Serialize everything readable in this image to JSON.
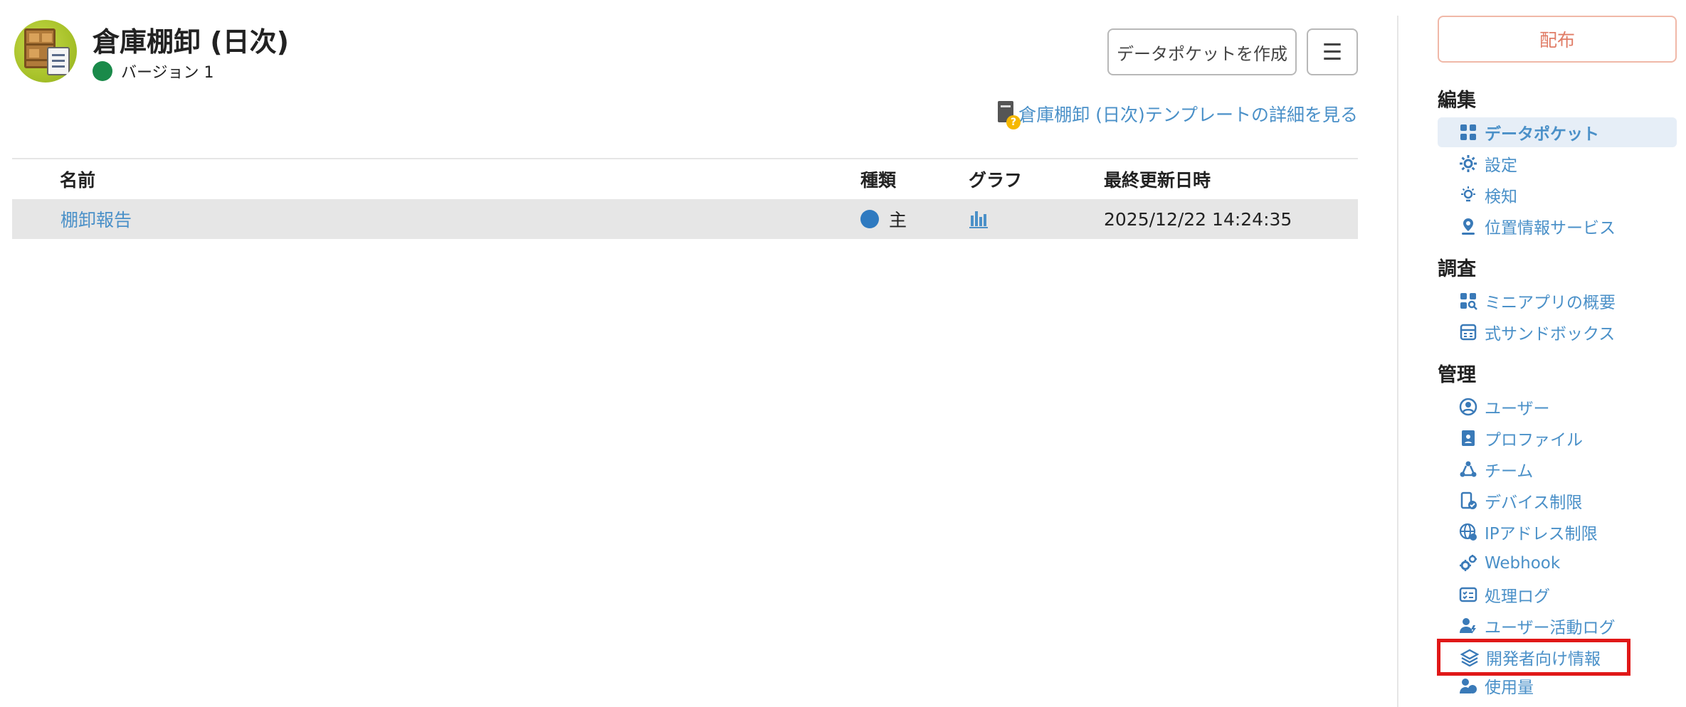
{
  "header": {
    "title": "倉庫棚卸 (日次)",
    "version": "バージョン 1",
    "create_button": "データポケットを作成",
    "menu_button": "☰",
    "template_link": "倉庫棚卸 (日次)テンプレートの詳細を見る"
  },
  "table": {
    "columns": [
      "名前",
      "種類",
      "グラフ",
      "最終更新日時"
    ],
    "rows": [
      {
        "name": "棚卸報告",
        "type": "主",
        "updated": "2025/12/22 14:24:35"
      }
    ]
  },
  "sidebar": {
    "distribute_button": "配布",
    "sections": [
      {
        "title": "編集",
        "items": [
          "データポケット",
          "設定",
          "検知",
          "位置情報サービス"
        ]
      },
      {
        "title": "調査",
        "items": [
          "ミニアプリの概要",
          "式サンドボックス"
        ]
      },
      {
        "title": "管理",
        "items": [
          "ユーザー",
          "プロファイル",
          "チーム",
          "デバイス制限",
          "IPアドレス制限",
          "Webhook",
          "処理ログ",
          "ユーザー活動ログ",
          "開発者向け情報",
          "使用量"
        ]
      }
    ]
  },
  "colors": {
    "link": "#4a90c8",
    "status_green": "#1a8a4a",
    "type_blue": "#2f7ac0",
    "distribute_accent": "#e07c66",
    "highlight_red": "#e01818"
  }
}
